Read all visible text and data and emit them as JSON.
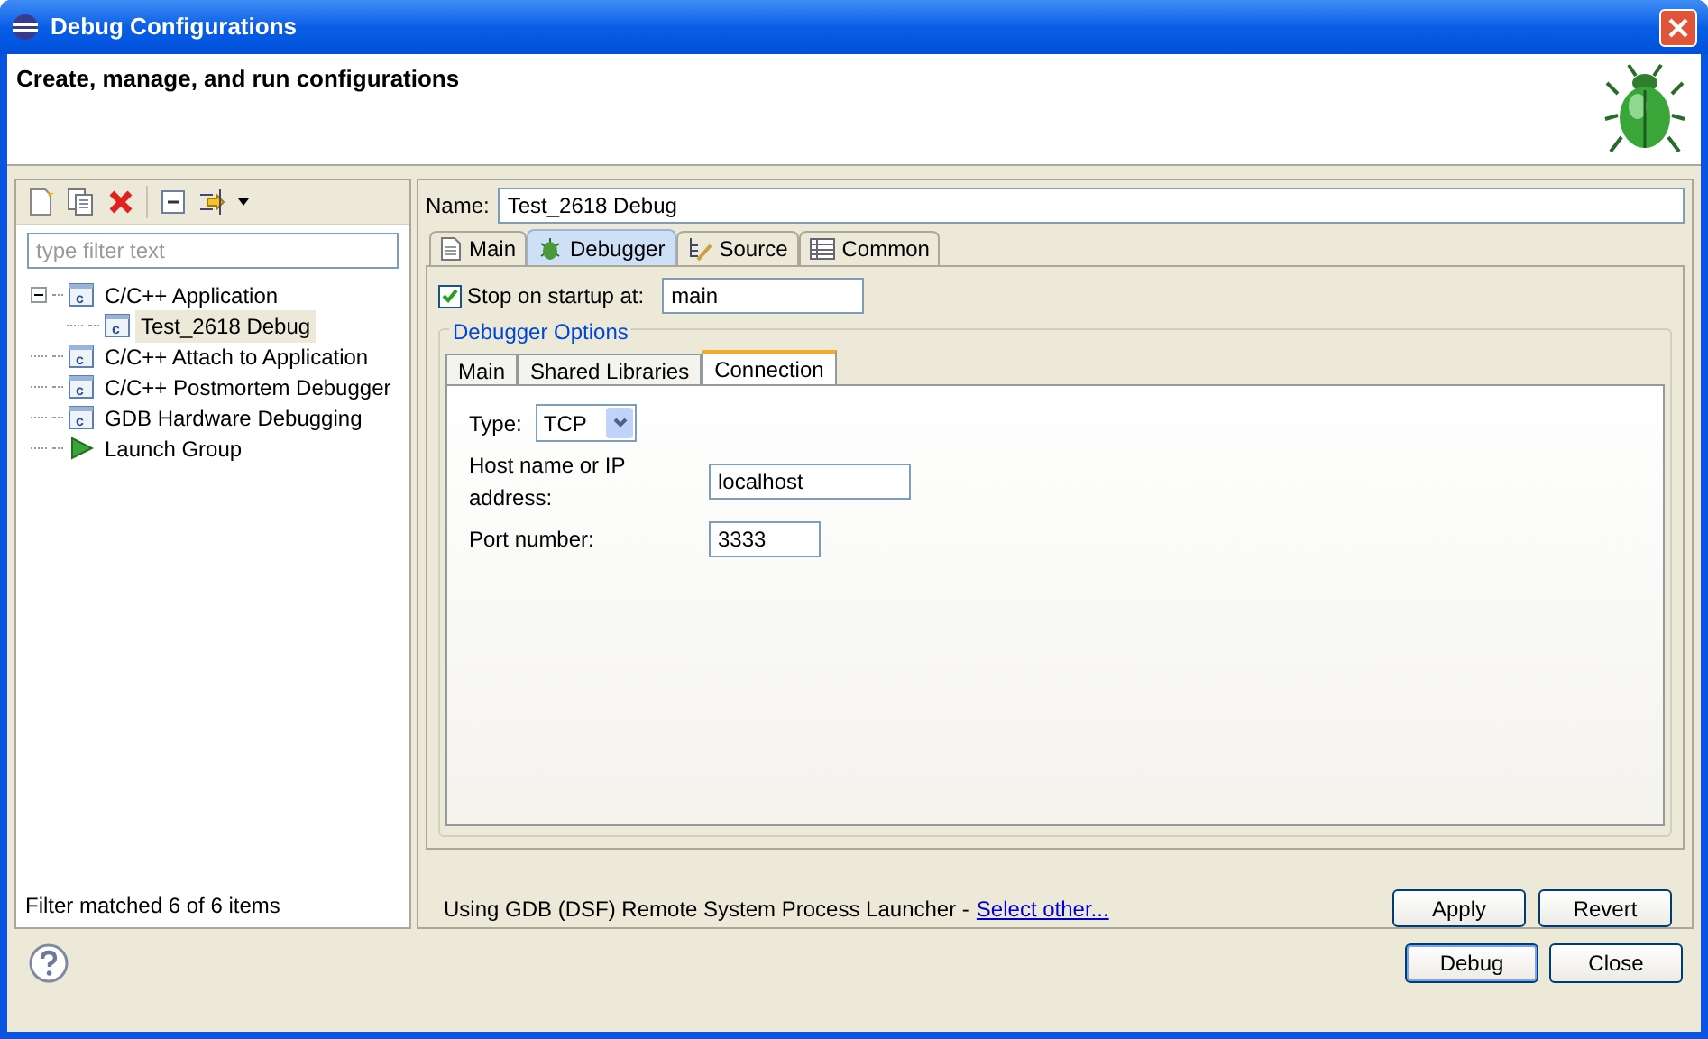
{
  "window": {
    "title": "Debug Configurations"
  },
  "header": {
    "title": "Create, manage, and run configurations"
  },
  "filter": {
    "placeholder": "type filter text"
  },
  "tree": [
    {
      "label": "C/C++ Application",
      "kind": "c",
      "expanded": true,
      "selected": false,
      "children": [
        {
          "label": "Test_2618 Debug",
          "kind": "c",
          "selected": true
        }
      ]
    },
    {
      "label": "C/C++ Attach to Application",
      "kind": "c",
      "selected": false
    },
    {
      "label": "C/C++ Postmortem Debugger",
      "kind": "c",
      "selected": false
    },
    {
      "label": "GDB Hardware Debugging",
      "kind": "c",
      "selected": false
    },
    {
      "label": "Launch Group",
      "kind": "launch",
      "selected": false
    }
  ],
  "filter_status": "Filter matched 6 of 6 items",
  "name": {
    "label": "Name:",
    "value": "Test_2618 Debug"
  },
  "tabs": [
    {
      "label": "Main",
      "kind": "page",
      "selected": false
    },
    {
      "label": "Debugger",
      "kind": "bug",
      "selected": true
    },
    {
      "label": "Source",
      "kind": "source",
      "selected": false
    },
    {
      "label": "Common",
      "kind": "table",
      "selected": false
    }
  ],
  "stop_on_startup": {
    "label": "Stop on startup at:",
    "checked": true,
    "value": "main"
  },
  "options": {
    "title": "Debugger Options",
    "tabs": [
      {
        "label": "Main",
        "selected": false
      },
      {
        "label": "Shared Libraries",
        "selected": false
      },
      {
        "label": "Connection",
        "selected": true
      }
    ],
    "type": {
      "label": "Type:",
      "value": "TCP"
    },
    "host": {
      "label": "Host name or IP address:",
      "value": "localhost"
    },
    "port": {
      "label": "Port number:",
      "value": "3333"
    }
  },
  "launcher": {
    "text": "Using GDB (DSF) Remote System Process Launcher -",
    "link": "Select other..."
  },
  "panel_buttons": [
    "Apply",
    "Revert"
  ],
  "dialog_buttons": [
    {
      "label": "Debug",
      "default": true
    },
    {
      "label": "Close",
      "default": false
    }
  ]
}
